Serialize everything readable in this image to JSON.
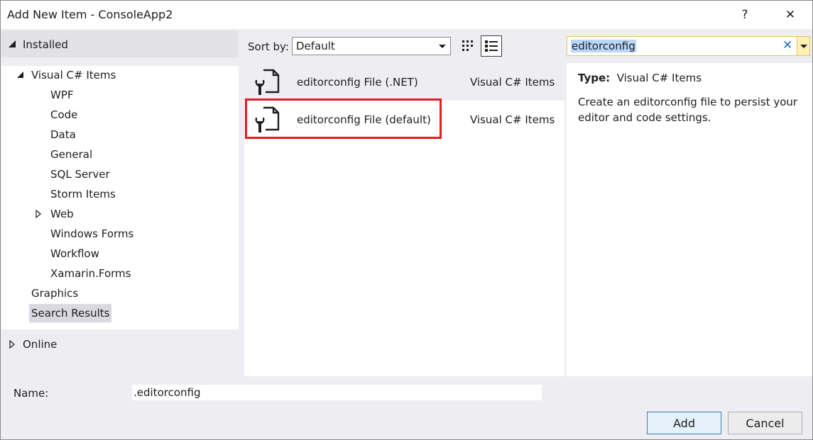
{
  "window": {
    "title": "Add New Item - ConsoleApp2",
    "help_label": "?",
    "close_label": "✕"
  },
  "left": {
    "installed_label": "Installed",
    "tree": [
      {
        "label": "Visual C# Items"
      },
      {
        "label": "WPF"
      },
      {
        "label": "Code"
      },
      {
        "label": "Data"
      },
      {
        "label": "General"
      },
      {
        "label": "SQL Server"
      },
      {
        "label": "Storm Items"
      },
      {
        "label": "Web"
      },
      {
        "label": "Windows Forms"
      },
      {
        "label": "Workflow"
      },
      {
        "label": "Xamarin.Forms"
      },
      {
        "label": "Graphics"
      },
      {
        "label": "Search Results"
      }
    ],
    "online_label": "Online"
  },
  "toolbar": {
    "sort_label": "Sort by:",
    "sort_value": "Default"
  },
  "search": {
    "value": "editorconfig",
    "clear_label": "✕"
  },
  "items": [
    {
      "name": "editorconfig File (.NET)",
      "category": "Visual C# Items"
    },
    {
      "name": "editorconfig File (default)",
      "category": "Visual C# Items"
    }
  ],
  "details": {
    "type_label": "Type:",
    "type_value": "Visual C# Items",
    "description": "Create an editorconfig file to persist your editor and code settings."
  },
  "bottom": {
    "name_label": "Name:",
    "name_value": ".editorconfig",
    "add_label": "Add",
    "cancel_label": "Cancel"
  },
  "colors": {
    "highlight_box": "#e31b23",
    "search_border": "#e5c365",
    "selection": "#b8d6fb"
  }
}
